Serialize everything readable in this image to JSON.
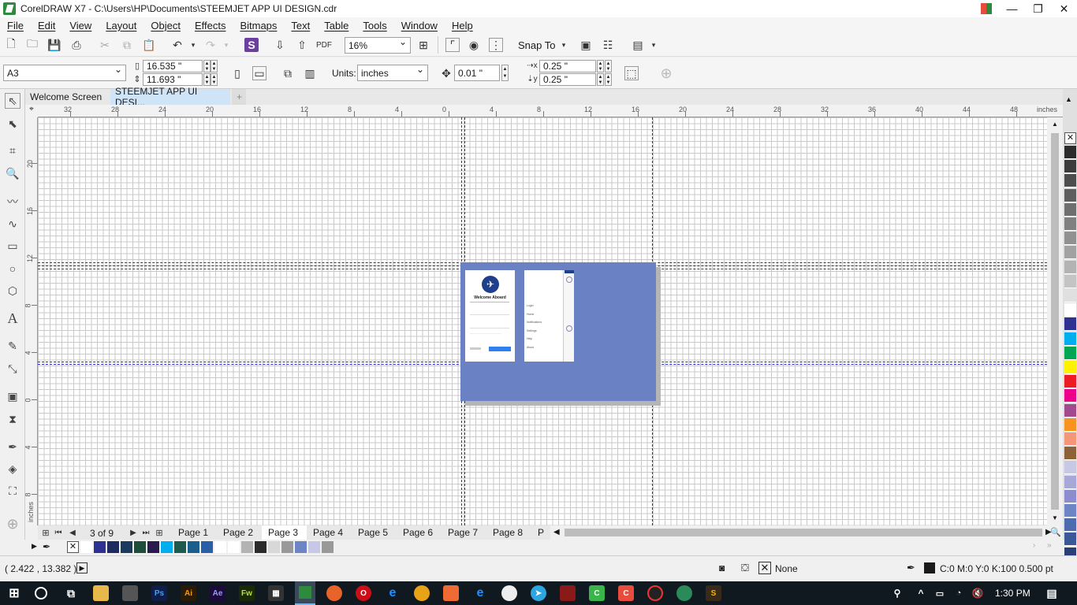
{
  "window": {
    "title": "CorelDRAW X7 - C:\\Users\\HP\\Documents\\STEEMJET APP UI DESIGN.cdr"
  },
  "menu": [
    "File",
    "Edit",
    "View",
    "Layout",
    "Object",
    "Effects",
    "Bitmaps",
    "Text",
    "Table",
    "Tools",
    "Window",
    "Help"
  ],
  "toolbar": {
    "zoom": "16%",
    "snap_to": "Snap To"
  },
  "propertybar": {
    "page_size": "A3",
    "width": "16.535 \"",
    "height": "11.693 \"",
    "units_label": "Units:",
    "units": "inches",
    "nudge": "0.01 \"",
    "dup_x": "0.25 \"",
    "dup_y": "0.25 \""
  },
  "doc_tabs": [
    "Welcome Screen",
    "STEEMJET APP UI DESI..."
  ],
  "ruler": {
    "unit": "inches",
    "h_ticks": [
      "32",
      "28",
      "24",
      "20",
      "16",
      "12",
      "8",
      "4",
      "0",
      "4",
      "8",
      "12",
      "16",
      "20",
      "24",
      "28",
      "32",
      "36",
      "40",
      "44",
      "48"
    ],
    "v_ticks": [
      "20",
      "16",
      "12",
      "8",
      "4",
      "0",
      "4",
      "8"
    ]
  },
  "mockup": {
    "title": "Welcome Aboard",
    "menu_items": [
      "Login",
      "Home",
      "Notifications",
      "Settings",
      "Help",
      "About"
    ]
  },
  "pagenav": {
    "counter": "3 of 9",
    "pages": [
      "Page 1",
      "Page 2",
      "Page 3",
      "Page 4",
      "Page 5",
      "Page 6",
      "Page 7",
      "Page 8",
      "P"
    ],
    "active": "Page 3"
  },
  "palette": [
    "#2b2b2b",
    "#3c3c3c",
    "#4d4d4d",
    "#5e5e5e",
    "#6f6f6f",
    "#808080",
    "#919191",
    "#a2a2a2",
    "#b3b3b3",
    "#c4c4c4",
    "#e0e0e0",
    "#ffffff",
    "#2e3192",
    "#00aeef",
    "#00a651",
    "#fff200",
    "#ed1c24",
    "#ec008c",
    "#a3498e",
    "#f7941d",
    "#f69679",
    "#8c6239",
    "#c7c7e6",
    "#a8a8d8",
    "#8c8ccf",
    "#6d85c5",
    "#4d6cb0",
    "#3b5998",
    "#2c3e7a",
    "#1e2b5e"
  ],
  "doc_palette": [
    "#ffffff",
    "#2e3192",
    "#1e2b5e",
    "#1a3a5e",
    "#1e4d3a",
    "#2a1a4d",
    "#00aeef",
    "#1e5a4e",
    "#1a5e8c",
    "#2a5ea8",
    "#ffffff",
    "#ffffff",
    "#b3b3b3",
    "#2b2b2b",
    "#d8d8d8",
    "#999999",
    "#6d85c5",
    "#c7c7e6",
    "#999999"
  ],
  "status": {
    "coords": "( 2.422 , 13.382 )",
    "fill": "None",
    "outline": "C:0 M:0 Y:0 K:100  0.500 pt"
  },
  "taskbar": {
    "time": "1:30 PM"
  }
}
